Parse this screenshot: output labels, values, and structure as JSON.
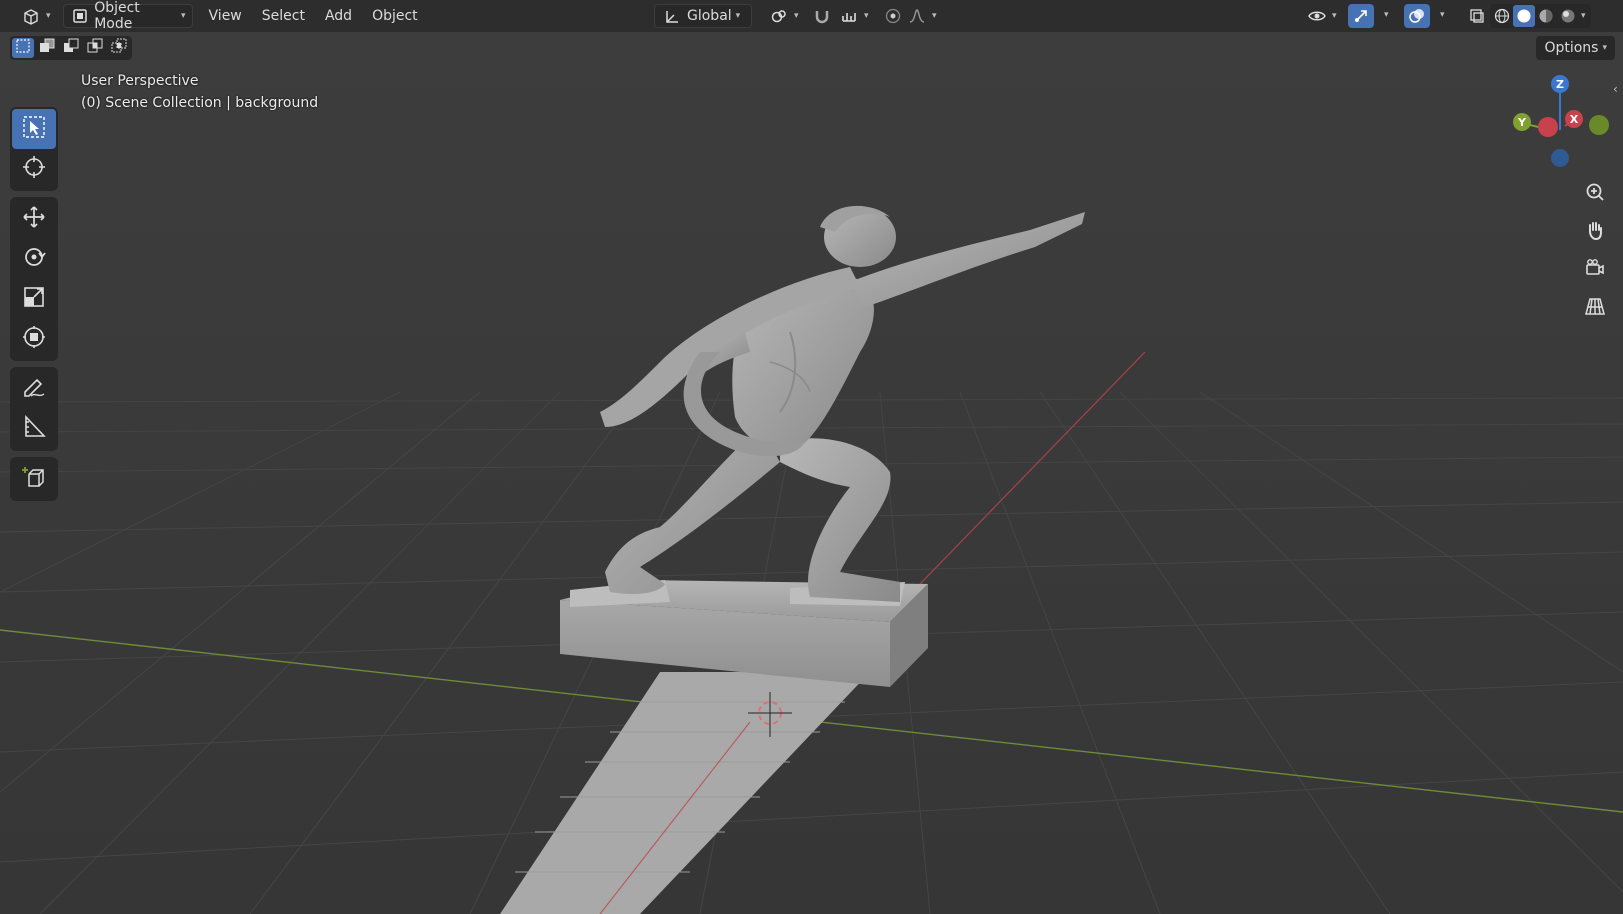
{
  "header": {
    "editor_type_icon": "3d-viewport-icon",
    "mode": {
      "label": "Object Mode",
      "icon": "object-mode-icon"
    },
    "menus": [
      "View",
      "Select",
      "Add",
      "Object"
    ],
    "transform_orientation": {
      "label": "Global",
      "icon": "orientation-icon"
    },
    "pivot_icon": "pivot-point-icon",
    "snap_icon": "snap-magnet-icon",
    "snap_target_icon": "snap-increment-icon",
    "proportional_icon": "proportional-edit-icon",
    "falloff_icon": "falloff-curve-icon",
    "right_icons": [
      "visibility-eye-icon",
      "gizmo-toggle-icon",
      "overlay-toggle-icon",
      "xray-icon",
      "wireframe-shading-icon",
      "solid-shading-icon",
      "material-shading-icon",
      "rendered-shading-icon"
    ]
  },
  "selection_modes": [
    "select-new-icon",
    "select-extend-icon",
    "select-subtract-icon",
    "select-invert-icon",
    "select-intersect-icon"
  ],
  "options_label": "Options",
  "viewport": {
    "perspective_label": "User Perspective",
    "collection_label": "(0) Scene Collection | background"
  },
  "toolbar": {
    "tools": [
      {
        "name": "select-box-icon",
        "active": true
      },
      {
        "name": "cursor-icon",
        "active": false
      },
      {
        "name": "move-icon",
        "active": false
      },
      {
        "name": "rotate-icon",
        "active": false
      },
      {
        "name": "scale-icon",
        "active": false
      },
      {
        "name": "transform-icon",
        "active": false
      },
      {
        "name": "annotate-icon",
        "active": false
      },
      {
        "name": "measure-icon",
        "active": false
      },
      {
        "name": "add-cube-icon",
        "active": false
      }
    ]
  },
  "gizmo": {
    "z": "Z",
    "y": "Y",
    "x": "X"
  },
  "colors": {
    "accent": "#4772b3",
    "x_axis": "#c8424c",
    "y_axis": "#7ea12f",
    "z_axis": "#3a78d0",
    "header_bg": "#2d2d2d",
    "viewport_bg": "#3a3a3a"
  },
  "nav_buttons": [
    "zoom-icon",
    "pan-hand-icon",
    "camera-view-icon",
    "ortho-grid-icon"
  ]
}
